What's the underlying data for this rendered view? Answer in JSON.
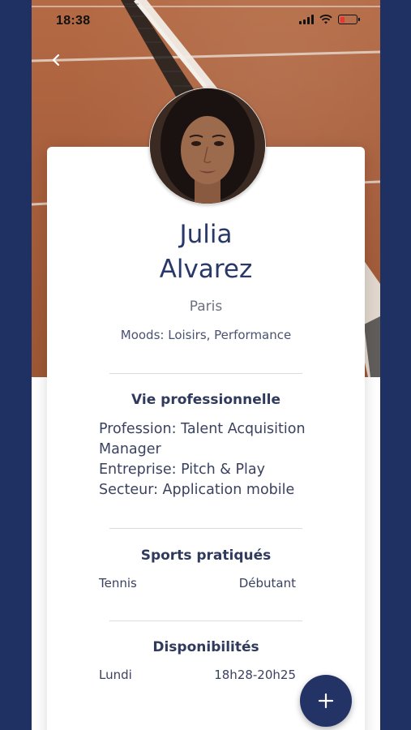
{
  "status_bar": {
    "time": "18:38"
  },
  "icons": {
    "back": "chevron-left-icon",
    "signal": "signal-icon",
    "wifi": "wifi-icon",
    "battery": "battery-icon",
    "add": "plus-icon"
  },
  "colors": {
    "brand_navy": "#233366",
    "title_text": "#283869",
    "court_clay": "#a85f3c"
  },
  "profile": {
    "first_name": "Julia",
    "last_name": "Alvarez",
    "city": "Paris",
    "moods_label": "Moods: ",
    "moods_value": "Loisirs, Performance"
  },
  "professional": {
    "title": "Vie professionnelle",
    "lines": [
      "Profession: Talent Acquisition",
      "Manager",
      "Entreprise: Pitch & Play",
      "Secteur: Application mobile"
    ]
  },
  "sports": {
    "title": "Sports pratiqués",
    "items": [
      {
        "sport": "Tennis",
        "level": "Débutant"
      }
    ]
  },
  "availability": {
    "title": "Disponibilités",
    "items": [
      {
        "day": "Lundi",
        "hours": "18h28-20h25"
      }
    ]
  }
}
